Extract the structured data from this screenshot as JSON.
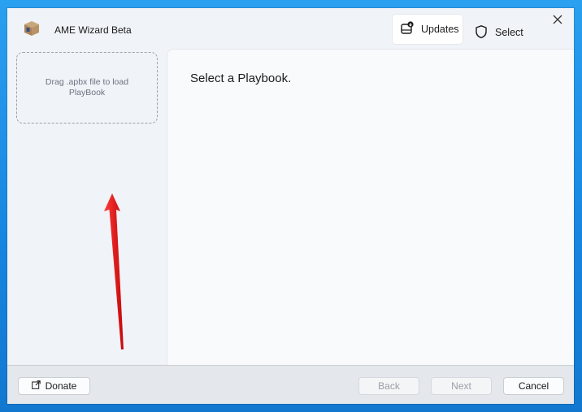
{
  "window": {
    "title": "AME Wizard Beta",
    "header_buttons": {
      "updates_label": "Updates",
      "select_label": "Select"
    }
  },
  "sidebar": {
    "dropzone_text": "Drag .apbx file to load PlayBook"
  },
  "main": {
    "title": "Select a Playbook."
  },
  "footer": {
    "donate_label": "Donate",
    "back_label": "Back",
    "next_label": "Next",
    "cancel_label": "Cancel"
  },
  "icons": {
    "app": "box-icon",
    "updates": "updates-icon",
    "select": "shield-icon",
    "close": "close-icon",
    "donate": "external-link-icon"
  },
  "colors": {
    "annotation_arrow": "#e01010",
    "desktop_background": "#1f8fe6"
  }
}
